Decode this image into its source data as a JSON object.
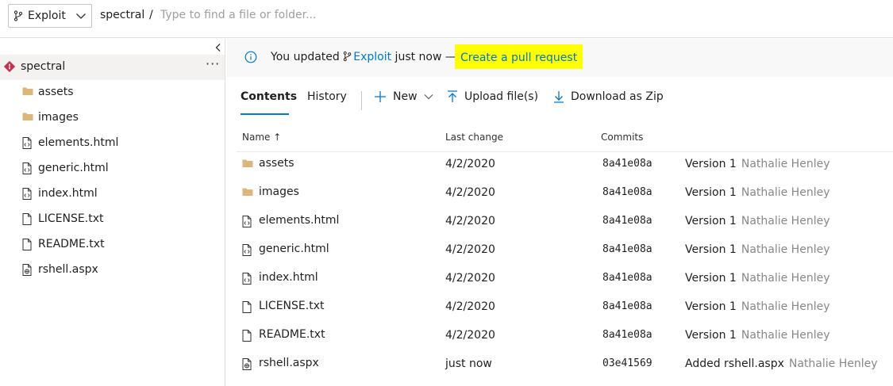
{
  "header": {
    "branch": "Exploit",
    "repo": "spectral",
    "separator": "/",
    "search_placeholder": "Type to find a file or folder..."
  },
  "sidebar": {
    "root_label": "spectral",
    "more_label": "···",
    "items": [
      {
        "label": "assets",
        "icon": "folder-icon"
      },
      {
        "label": "images",
        "icon": "folder-icon"
      },
      {
        "label": "elements.html",
        "icon": "code-file-icon"
      },
      {
        "label": "generic.html",
        "icon": "code-file-icon"
      },
      {
        "label": "index.html",
        "icon": "code-file-icon"
      },
      {
        "label": "LICENSE.txt",
        "icon": "text-file-icon"
      },
      {
        "label": "README.txt",
        "icon": "text-file-icon"
      },
      {
        "label": "rshell.aspx",
        "icon": "web-file-icon"
      }
    ]
  },
  "banner": {
    "prefix": "You updated ",
    "branch": "Exploit",
    "suffix": " just now — ",
    "link": "Create a pull request"
  },
  "tabs": {
    "contents": "Contents",
    "history": "History"
  },
  "commands": {
    "new": "New",
    "upload": "Upload file(s)",
    "download": "Download as Zip"
  },
  "table": {
    "headers": {
      "name": "Name ↑",
      "last_change": "Last change",
      "commits": "Commits"
    },
    "rows": [
      {
        "name": "assets",
        "icon": "folder-icon",
        "date": "4/2/2020",
        "commit": "8a41e08a",
        "message": "Version 1",
        "author": "Nathalie Henley"
      },
      {
        "name": "images",
        "icon": "folder-icon",
        "date": "4/2/2020",
        "commit": "8a41e08a",
        "message": "Version 1",
        "author": "Nathalie Henley"
      },
      {
        "name": "elements.html",
        "icon": "code-file-icon",
        "date": "4/2/2020",
        "commit": "8a41e08a",
        "message": "Version 1",
        "author": "Nathalie Henley"
      },
      {
        "name": "generic.html",
        "icon": "code-file-icon",
        "date": "4/2/2020",
        "commit": "8a41e08a",
        "message": "Version 1",
        "author": "Nathalie Henley"
      },
      {
        "name": "index.html",
        "icon": "code-file-icon",
        "date": "4/2/2020",
        "commit": "8a41e08a",
        "message": "Version 1",
        "author": "Nathalie Henley"
      },
      {
        "name": "LICENSE.txt",
        "icon": "text-file-icon",
        "date": "4/2/2020",
        "commit": "8a41e08a",
        "message": "Version 1",
        "author": "Nathalie Henley"
      },
      {
        "name": "README.txt",
        "icon": "text-file-icon",
        "date": "4/2/2020",
        "commit": "8a41e08a",
        "message": "Version 1",
        "author": "Nathalie Henley"
      },
      {
        "name": "rshell.aspx",
        "icon": "web-file-icon",
        "date": "just now",
        "commit": "03e41569",
        "message": "Added rshell.aspx",
        "author": "Nathalie Henley"
      }
    ]
  },
  "colors": {
    "accent": "#0078d4",
    "highlight": "#ffff00",
    "folder": "#dcb67a",
    "repo": "#c4314b"
  }
}
